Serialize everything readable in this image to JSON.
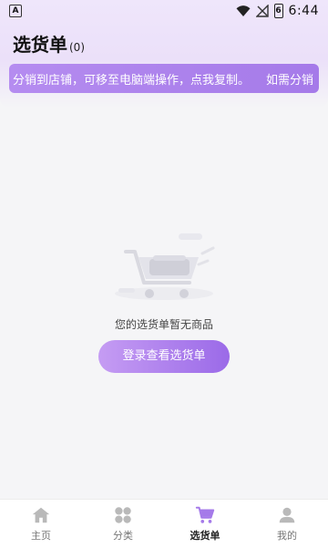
{
  "status": {
    "left_icon": "A",
    "time": "6:44",
    "battery": "6"
  },
  "header": {
    "title": "选货单",
    "count": "(0)"
  },
  "notice": {
    "text": "分销到店铺，可移至电脑端操作，点我复制。",
    "link": "如需分销"
  },
  "empty": {
    "message": "您的选货单暂无商品",
    "button": "登录查看选货单"
  },
  "tabbar": {
    "items": [
      {
        "label": "主页",
        "icon": "home-icon"
      },
      {
        "label": "分类",
        "icon": "category-icon"
      },
      {
        "label": "选货单",
        "icon": "cart-icon"
      },
      {
        "label": "我的",
        "icon": "user-icon"
      }
    ],
    "active_index": 2
  },
  "colors": {
    "accent": "#a57ae9",
    "accent_light": "#c59cf3",
    "inactive": "#b9b9b9"
  }
}
